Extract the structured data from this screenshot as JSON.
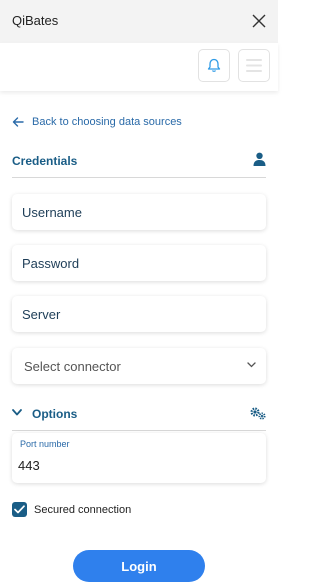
{
  "app": {
    "title": "QiBates"
  },
  "header": {
    "bell_icon": "bell-icon",
    "menu_icon": "hamburger-menu-icon"
  },
  "back_link": {
    "label": "Back to choosing data sources"
  },
  "credentials": {
    "title": "Credentials",
    "username_placeholder": "Username",
    "password_placeholder": "Password",
    "server_placeholder": "Server",
    "connector_label": "Select connector"
  },
  "options": {
    "title": "Options",
    "port_label": "Port number",
    "port_value": "443",
    "secured_label": "Secured connection",
    "secured_checked": true
  },
  "actions": {
    "login_label": "Login"
  },
  "colors": {
    "accent": "#1a5d86",
    "link": "#2a6aa8",
    "button": "#2f80ed"
  }
}
